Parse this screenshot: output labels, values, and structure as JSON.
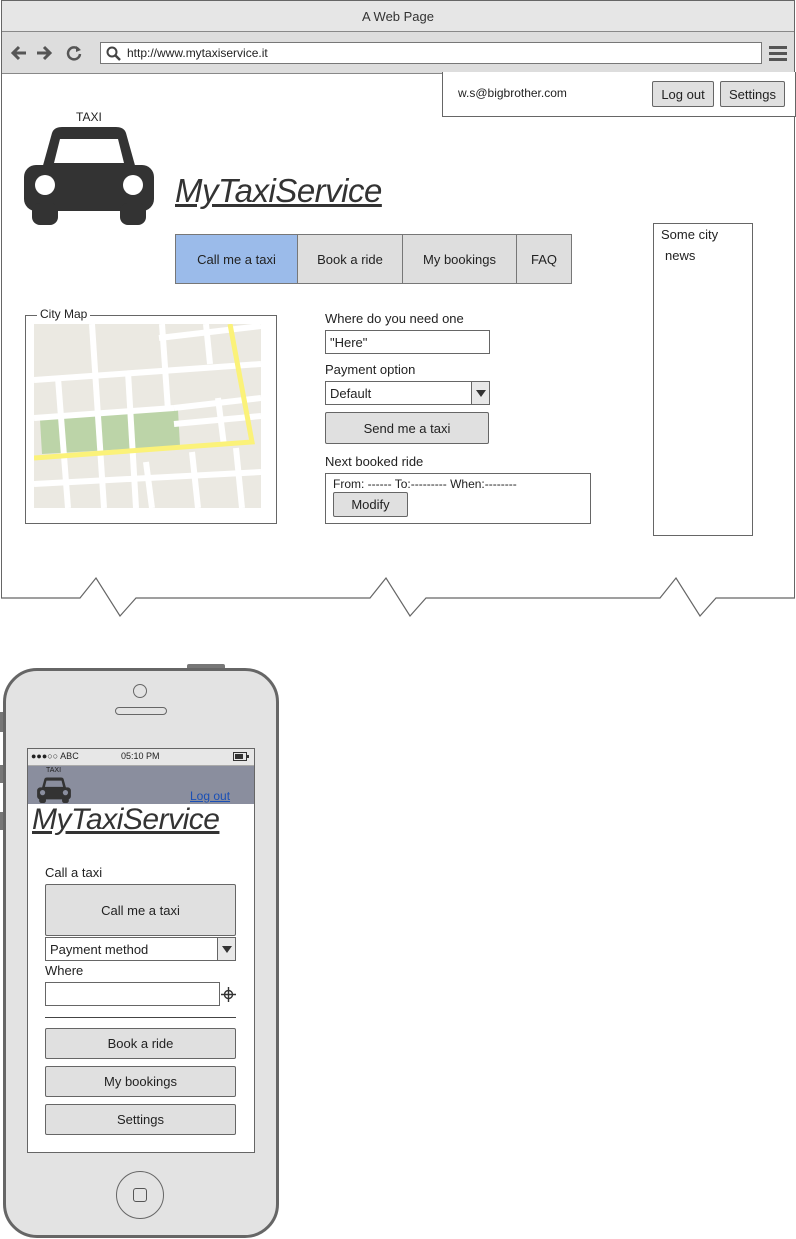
{
  "browser": {
    "title": "A Web Page",
    "url": "http://www.mytaxiservice.it"
  },
  "account": {
    "email": "w.s@bigbrother.com",
    "logout_label": "Log out",
    "settings_label": "Settings"
  },
  "logo": {
    "taxi_label": "TAXI",
    "brand": "MyTaxiService"
  },
  "nav": {
    "tabs": [
      {
        "label": "Call me a taxi",
        "active": true
      },
      {
        "label": "Book a ride",
        "active": false
      },
      {
        "label": "My bookings",
        "active": false
      },
      {
        "label": "FAQ",
        "active": false
      }
    ]
  },
  "map": {
    "title": "City Map"
  },
  "form": {
    "where_label": "Where do you need one",
    "where_value": "\"Here\"",
    "payment_label": "Payment option",
    "payment_value": "Default",
    "send_label": "Send me a taxi",
    "next_label": "Next booked ride",
    "next_details": "From: ------ To:--------- When:--------",
    "modify_label": "Modify"
  },
  "news": {
    "line1": "Some city",
    "line2": "news"
  },
  "colors": {
    "active_tab": "#9bbbea",
    "mobile_header": "#8a8e9e"
  },
  "mobile": {
    "status": {
      "carrier": "●●●○○ ABC",
      "time": "05:10 PM"
    },
    "taxi_label": "TAXI",
    "logout_label": "Log out",
    "brand": "MyTaxiService",
    "section_label": "Call a taxi",
    "call_label": "Call me a taxi",
    "payment_value": "Payment method",
    "where_label": "Where",
    "where_value": "",
    "book_label": "Book a ride",
    "bookings_label": "My bookings",
    "settings_label": "Settings"
  }
}
